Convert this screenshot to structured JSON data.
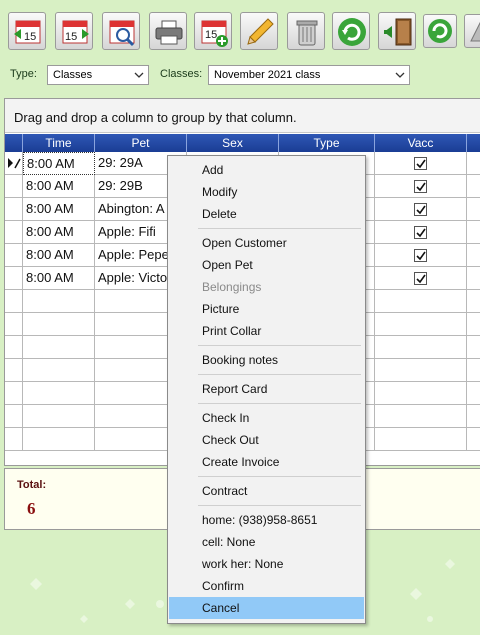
{
  "toolbar": {
    "buttons": [
      {
        "name": "calendar-previous-icon",
        "label": "15"
      },
      {
        "name": "calendar-next-icon",
        "label": "15"
      },
      {
        "name": "calendar-search-icon",
        "label": ""
      },
      {
        "name": "printer-icon",
        "label": ""
      },
      {
        "name": "calendar-add-icon",
        "label": "15"
      },
      {
        "name": "pencil-icon",
        "label": ""
      },
      {
        "name": "trash-can-icon",
        "label": ""
      },
      {
        "name": "refresh-icon",
        "label": ""
      },
      {
        "name": "door-enter-icon",
        "label": ""
      },
      {
        "name": "refresh-small-icon",
        "label": ""
      },
      {
        "name": "triangle-icon",
        "label": ""
      }
    ]
  },
  "filters": {
    "type_label": "Type:",
    "type_value": "Classes",
    "classes_label": "Classes:",
    "classes_value": "November 2021 class"
  },
  "grid": {
    "group_hint": "Drag and drop a column to group by that column.",
    "columns": [
      "Time",
      "Pet",
      "Sex",
      "Type",
      "Vacc"
    ],
    "rows": [
      {
        "time": "8:00 AM",
        "pet": "29: 29A",
        "vacc": true
      },
      {
        "time": "8:00 AM",
        "pet": "29: 29B",
        "vacc": true
      },
      {
        "time": "8:00 AM",
        "pet": "Abington: A",
        "vacc": true
      },
      {
        "time": "8:00 AM",
        "pet": "Apple: Fifi",
        "vacc": true
      },
      {
        "time": "8:00 AM",
        "pet": "Apple: Pepe",
        "vacc": true
      },
      {
        "time": "8:00 AM",
        "pet": "Apple: Victo",
        "vacc": true
      }
    ]
  },
  "totals": {
    "label": "Total:",
    "value": "6"
  },
  "context_menu": {
    "items": [
      {
        "label": "Add",
        "enabled": true
      },
      {
        "label": "Modify",
        "enabled": true
      },
      {
        "label": "Delete",
        "enabled": true
      },
      {
        "label": "Open Customer",
        "enabled": true
      },
      {
        "label": "Open Pet",
        "enabled": true
      },
      {
        "label": "Belongings",
        "enabled": false
      },
      {
        "label": "Picture",
        "enabled": true
      },
      {
        "label": "Print Collar",
        "enabled": true
      },
      {
        "label": "Booking notes",
        "enabled": true
      },
      {
        "label": "Report Card",
        "enabled": true
      },
      {
        "label": "Check In",
        "enabled": true
      },
      {
        "label": "Check Out",
        "enabled": true
      },
      {
        "label": "Create Invoice",
        "enabled": true
      },
      {
        "label": "Contract",
        "enabled": true
      },
      {
        "label": "home: (938)958-8651",
        "enabled": true
      },
      {
        "label": "cell: None",
        "enabled": true
      },
      {
        "label": "work her: None",
        "enabled": true
      },
      {
        "label": "Confirm",
        "enabled": true
      },
      {
        "label": "Cancel",
        "enabled": true,
        "highlighted": true
      }
    ]
  },
  "colors": {
    "background": "#d8f0c4",
    "header": "#1f46a0",
    "menu_highlight": "#91c9f7",
    "total_value": "#8a1010"
  }
}
